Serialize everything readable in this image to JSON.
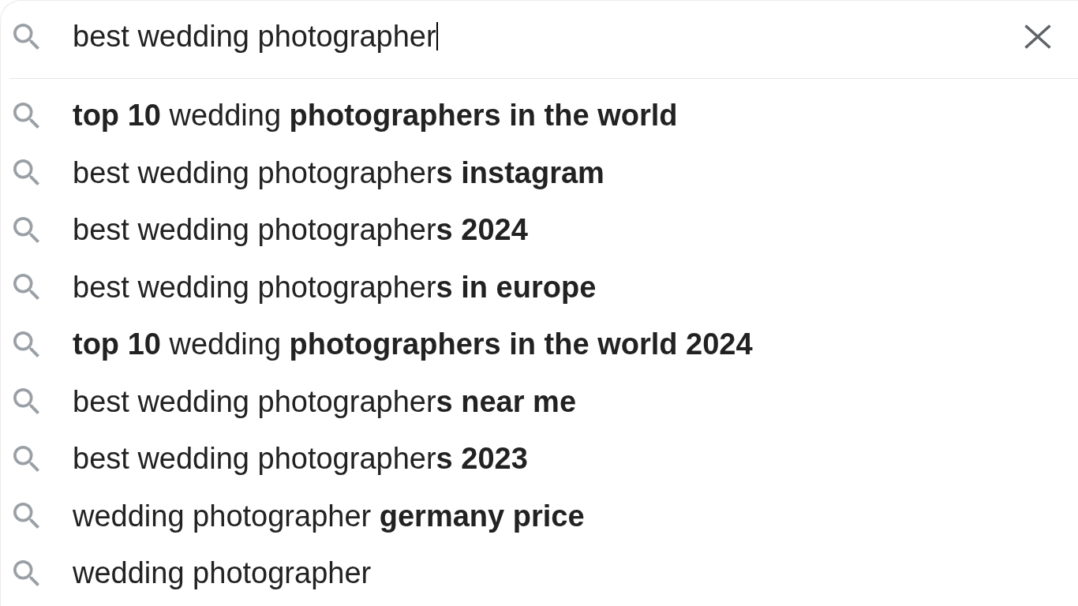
{
  "search": {
    "value": "best wedding photographer",
    "focused": true
  },
  "suggestions": [
    {
      "text": "**top 10** wedding **photographers in the world**"
    },
    {
      "text": "best wedding photographer**s instagram**"
    },
    {
      "text": "best wedding photographer**s 2024**"
    },
    {
      "text": "best wedding photographer**s in europe**"
    },
    {
      "text": "**top 10** wedding **photographers in the world 2024**"
    },
    {
      "text": "best wedding photographer**s near me**"
    },
    {
      "text": "best wedding photographer**s 2023**"
    },
    {
      "text": "wedding photographer **germany price**"
    },
    {
      "text": "wedding photographer"
    }
  ]
}
